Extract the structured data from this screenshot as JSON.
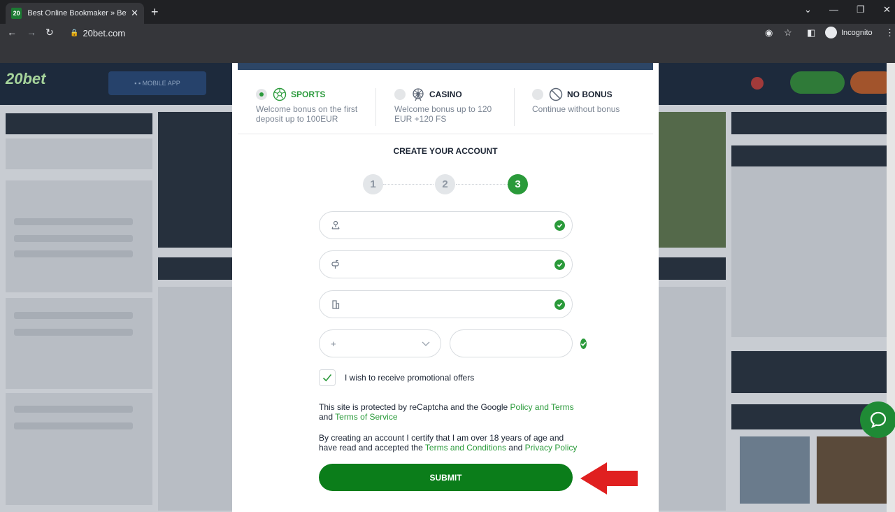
{
  "browser": {
    "tab_title": "Best Online Bookmaker » Bet Leg",
    "favicon_text": "20",
    "url": "20bet.com",
    "profile_label": "Incognito"
  },
  "modal": {
    "bonuses": [
      {
        "title": "SPORTS",
        "description_line1": "Welcome bonus on the first",
        "description_line2": "deposit up to 100EUR",
        "selected": true,
        "icon": "soccer-ball-icon"
      },
      {
        "title": "CASINO",
        "description_line1": "Welcome bonus up to 120",
        "description_line2": "EUR +120 FS",
        "selected": false,
        "icon": "ferris-wheel-icon"
      },
      {
        "title": "NO BONUS",
        "description_line1": "Continue without bonus",
        "description_line2": "",
        "selected": false,
        "icon": "no-icon"
      }
    ],
    "create_title": "CREATE YOUR ACCOUNT",
    "steps": [
      "1",
      "2",
      "3"
    ],
    "active_step": "3",
    "fields": {
      "address_value": "",
      "postcode_value": "",
      "city_value": "",
      "phone_code": "+",
      "phone_value": ""
    },
    "promo_label": "I wish to receive promotional offers",
    "promo_checked": true,
    "recaptcha": {
      "text_before": "This site is protected by reCaptcha and the Google ",
      "link1": "Policy and Terms",
      "text_and": "and ",
      "link2": "Terms of Service"
    },
    "certify": {
      "line1": "By creating an account I certify that I am over 18 years of age and",
      "text_before": "have read and accepted the ",
      "link1": "Terms and Conditions",
      "text_and": " and ",
      "link2": "Privacy Policy"
    },
    "submit_label": "SUBMIT"
  },
  "colors": {
    "accent_green": "#2a9a3a",
    "submit_green": "#0b7d1a",
    "arrow_red": "#e02020"
  }
}
